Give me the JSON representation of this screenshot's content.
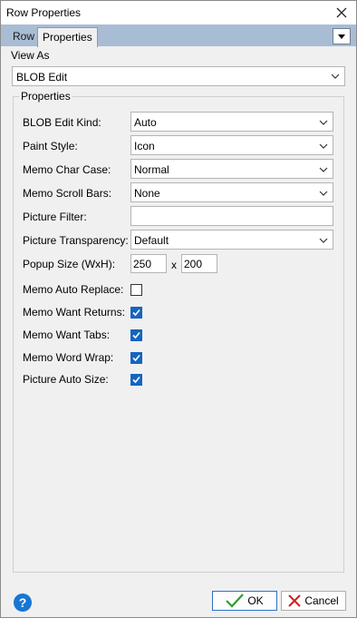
{
  "window": {
    "title": "Row Properties"
  },
  "tabs": [
    {
      "label": "Row",
      "active": false
    },
    {
      "label": "Properties",
      "active": true
    }
  ],
  "view_as": {
    "label": "View As",
    "value": "BLOB Edit"
  },
  "group": {
    "title": "Properties"
  },
  "properties": {
    "blob_edit_kind": {
      "label": "BLOB Edit Kind:",
      "value": "Auto"
    },
    "paint_style": {
      "label": "Paint Style:",
      "value": "Icon"
    },
    "memo_char_case": {
      "label": "Memo Char Case:",
      "value": "Normal"
    },
    "memo_scroll_bars": {
      "label": "Memo Scroll Bars:",
      "value": "None"
    },
    "picture_filter": {
      "label": "Picture Filter:",
      "value": ""
    },
    "picture_transparency": {
      "label": "Picture Transparency:",
      "value": "Default"
    },
    "popup_size": {
      "label": "Popup Size (WxH):",
      "width": "250",
      "separator": "x",
      "height": "200"
    },
    "memo_auto_replace": {
      "label": "Memo Auto Replace:",
      "checked": false
    },
    "memo_want_returns": {
      "label": "Memo Want Returns:",
      "checked": true
    },
    "memo_want_tabs": {
      "label": "Memo Want Tabs:",
      "checked": true
    },
    "memo_word_wrap": {
      "label": "Memo Word Wrap:",
      "checked": true
    },
    "picture_auto_size": {
      "label": "Picture Auto Size:",
      "checked": true
    }
  },
  "footer": {
    "help": "?",
    "ok_label": "OK",
    "cancel_label": "Cancel"
  },
  "colors": {
    "accent": "#1565c0",
    "tab_strip": "#a8bcd4",
    "ok_check": "#2e9e2e",
    "cancel_x": "#d02020"
  }
}
